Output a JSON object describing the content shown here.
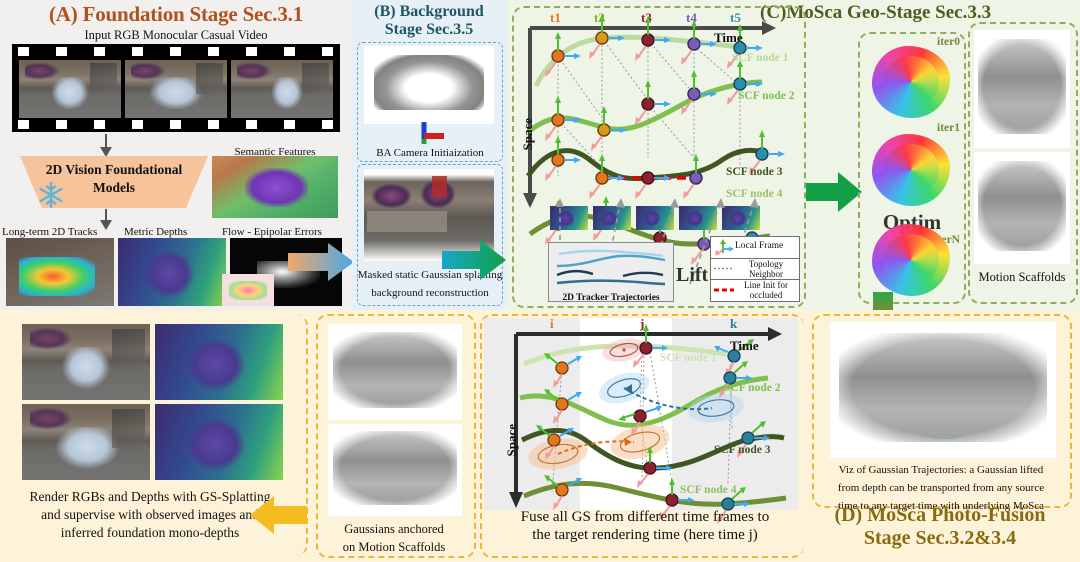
{
  "panelA": {
    "title": "(A) Foundation Stage Sec.3.1",
    "input_caption": "Input RGB Monocular Casual Video",
    "block_label_line1": "2D Vision Foundational",
    "block_label_line2": "Models",
    "frozen_icon": "snowflake-icon",
    "semantic_caption": "Semantic Features",
    "outputs": [
      "Long-term 2D Tracks",
      "Metric Depths",
      "Flow - Epipolar Errors"
    ],
    "title_color": "#b0521b",
    "block_color": "#f6c39a"
  },
  "panelB": {
    "title_line1": "(B) Background",
    "title_line2": "Stage Sec.3.5",
    "caption_top": "BA Camera Initiaization",
    "caption_bottom_line1": "Masked static Gaussian splatting",
    "caption_bottom_line2": "background reconstruction",
    "title_color": "#1d5763"
  },
  "panelC": {
    "title": "(C)MoSca Geo-Stage Sec.3.3",
    "axis_time": "Time",
    "axis_space": "Space",
    "time_ticks": [
      {
        "label": "t1",
        "color": "#e4761b"
      },
      {
        "label": "t2",
        "color": "#9aa81b"
      },
      {
        "label": "t3",
        "color": "#8b2230"
      },
      {
        "label": "t4",
        "color": "#7a5bb5"
      },
      {
        "label": "t5",
        "color": "#2a8fae"
      }
    ],
    "scf_nodes": [
      {
        "label": "SCF node 1",
        "color": "#b9d99a"
      },
      {
        "label": "SCF node 2",
        "color": "#7fbf4d"
      },
      {
        "label": "SCF node 3",
        "color": "#3f5522"
      },
      {
        "label": "SCF node 4",
        "color": "#8fbf5e"
      }
    ],
    "lift_label": "Lift",
    "tracker_box_label": "2D Tracker Trajectories",
    "legend": [
      {
        "label": "Local Frame",
        "icon": "local-frame-axes-icon"
      },
      {
        "label": "Topology\nNeighbor",
        "icon": "dotted-line-icon"
      },
      {
        "label": "Line Init for\noccluded",
        "icon": "red-dashed-line-icon"
      }
    ],
    "legend_rows": [
      "Local Frame",
      "Topology",
      "Neighbor",
      "Line Init for",
      "occluded"
    ],
    "optim_label": "Optim",
    "iterations": [
      "iter0",
      "iter1",
      "iterN"
    ],
    "scaffold_caption": "Motion Scaffolds",
    "title_color": "#4d5c1e"
  },
  "panelBottomLeft": {
    "caption_line1": "Render RGBs and Depths with GS-Splatting",
    "caption_line2": "and supervise with observed images and",
    "caption_line3": "inferred foundation mono-depths"
  },
  "panelGaussians": {
    "caption_line1": "Gaussians anchored",
    "caption_line2": "on Motion Scaffolds"
  },
  "panelFuse": {
    "axis_time": "Time",
    "axis_space": "Space",
    "time_ticks": [
      {
        "label": "i",
        "color": "#e4761b"
      },
      {
        "label": "j",
        "color": "#8b2230"
      },
      {
        "label": "k",
        "color": "#2a7f9e"
      }
    ],
    "scf_nodes": [
      {
        "label": "SCF node 1",
        "color": "#cfe3b0"
      },
      {
        "label": "SCF node 2",
        "color": "#7fbf4d"
      },
      {
        "label": "SCF node 3",
        "color": "#3f5522"
      },
      {
        "label": "SCF node 4",
        "color": "#8fbf5e"
      }
    ],
    "caption_line1": "Fuse all GS from different time frames to",
    "caption_line2": "the target rendering time (here time j)"
  },
  "panelD": {
    "viz_caption_line1": "Viz of Gaussian Trajectories: a Gaussian lifted",
    "viz_caption_line2": "from depth can be transported from any source",
    "viz_caption_line3": "time to any target time with underlying MoSca",
    "title_line1": "(D) MoSca Photo-Fusion",
    "title_line2": "Stage Sec.3.2&3.4",
    "title_color": "#8a6a10"
  },
  "arrows": {
    "a_to_b": "orange-to-blue-right-arrow",
    "b_to_c": "blue-to-green-right-arrow",
    "c_optim": "green-right-arrow",
    "c_to_d": "green-to-orange-down-arrow",
    "fuse_to_left": "yellow-left-arrow"
  }
}
